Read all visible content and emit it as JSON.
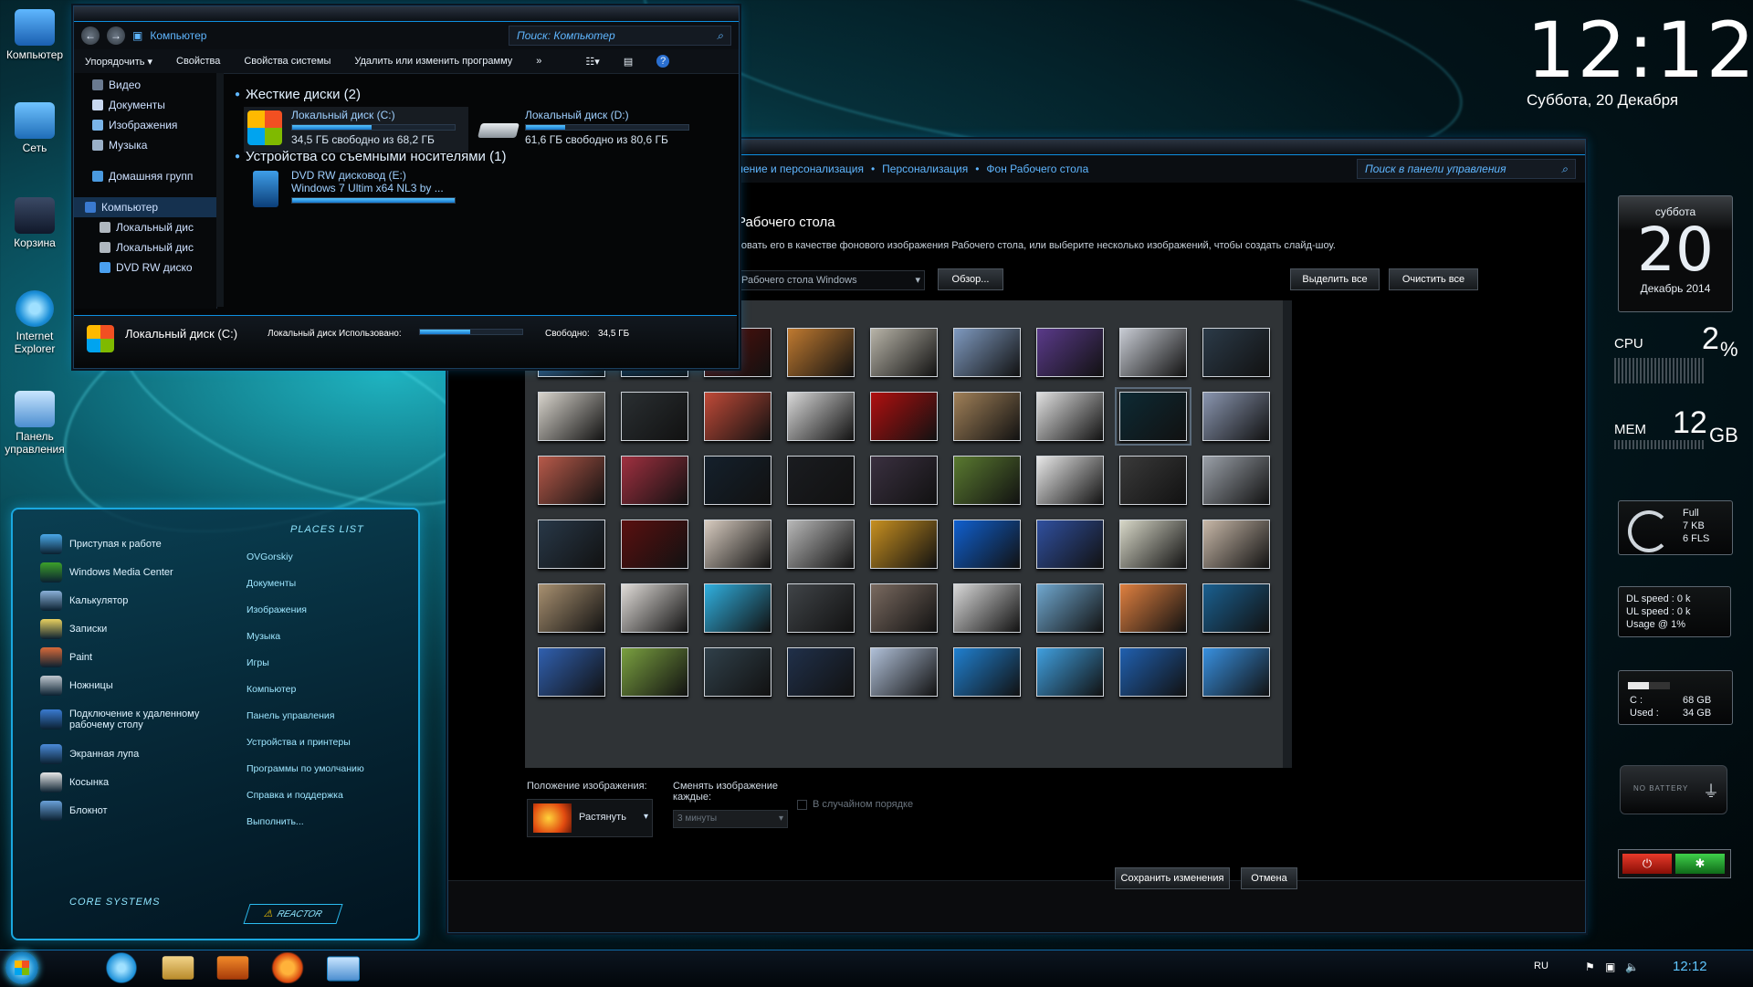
{
  "desktop_icons": [
    {
      "label": "Компьютер",
      "icon": "computer-icon"
    },
    {
      "label": "Сеть",
      "icon": "network-icon"
    },
    {
      "label": "Корзина",
      "icon": "recycle-bin-icon"
    },
    {
      "label": "Internet Explorer",
      "icon": "ie-icon"
    },
    {
      "label": "Панель управления",
      "icon": "control-panel-icon"
    }
  ],
  "clock": {
    "time": "12:12",
    "date": "Суббота, 20 Декабря"
  },
  "explorer": {
    "breadcrumb": "Компьютер",
    "search_placeholder": "Поиск: Компьютер",
    "toolbar": [
      "Упорядочить ▾",
      "Свойства",
      "Свойства системы",
      "Удалить или изменить программу",
      "»"
    ],
    "nav": [
      {
        "label": "Видео",
        "icon": "video-folder-icon"
      },
      {
        "label": "Документы",
        "icon": "documents-folder-icon"
      },
      {
        "label": "Изображения",
        "icon": "pictures-folder-icon"
      },
      {
        "label": "Музыка",
        "icon": "music-folder-icon"
      },
      {
        "label": "Домашняя групп",
        "icon": "homegroup-icon"
      },
      {
        "label": "Компьютер",
        "icon": "computer-icon"
      },
      {
        "label": "Локальный дис",
        "icon": "drive-icon"
      },
      {
        "label": "Локальный дис",
        "icon": "drive-icon"
      },
      {
        "label": "DVD RW диско",
        "icon": "dvd-icon"
      }
    ],
    "group_hdd": "Жесткие диски (2)",
    "group_removable": "Устройства со съемными носителями (1)",
    "drives": [
      {
        "name": "Локальный диск (C:)",
        "free": "34,5 ГБ свободно из 68,2 ГБ",
        "used_fraction": 0.49
      },
      {
        "name": "Локальный диск (D:)",
        "free": "61,6 ГБ свободно из 80,6 ГБ",
        "used_fraction": 0.24
      },
      {
        "name": "DVD RW дисковод (E:)",
        "free": "Windows 7 Ultim x64 NL3 by ...",
        "used_fraction": 1.0
      }
    ],
    "details": {
      "title": "Локальный диск (C:)",
      "type": "Локальный диск",
      "used_label": "Использовано:",
      "free_label": "Свободно:",
      "free_value": "34,5 ГБ"
    }
  },
  "control_panel": {
    "breadcrumb": [
      "ление и персонализация",
      "Персонализация",
      "Фон Рабочего стола"
    ],
    "search_placeholder": "Поиск в панели управления",
    "heading": "Рабочего стола",
    "description": "зовать его в качестве фонового изображения Рабочего стола, или выберите несколько изображений, чтобы создать слайд-шоу.",
    "location_value": "Рабочего стола Windows",
    "browse": "Обзор...",
    "select_all": "Выделить все",
    "clear_all": "Очистить все",
    "position_label": "Положение изображения:",
    "position_value": "Растянуть",
    "interval_label": "Сменять изображение каждые:",
    "interval_value": "3 минуты",
    "shuffle_label": "В случайном порядке",
    "save": "Сохранить изменения",
    "cancel": "Отмена",
    "thumb_colors": [
      [
        "#3a6ea0",
        "#12304a",
        "#5a0f0a",
        "#c07a30",
        "#b8b4a8",
        "#7f9ac0",
        "#5a3a8a",
        "#c8ccd4",
        "#2b3a48"
      ],
      [
        "#d8d4cc",
        "#2a2f32",
        "#c04a38",
        "#d8d8d8",
        "#b01010",
        "#a08058",
        "#e0e0e0",
        "#0d2a34",
        "#8a96b0"
      ],
      [
        "#b85a4a",
        "#a03040",
        "#14202c",
        "#1a1c20",
        "#3a3040",
        "#5a7a30",
        "#e8e8e8",
        "#3a3a3a",
        "#9aa0a8"
      ],
      [
        "#283848",
        "#5a1010",
        "#d8ccc0",
        "#b8b8b8",
        "#c89020",
        "#1060d0",
        "#3050a0",
        "#d8d8c8",
        "#c8b8a8"
      ],
      [
        "#a89070",
        "#e0dcd8",
        "#30b0e0",
        "#404448",
        "#7a6a60",
        "#d8d8d8",
        "#70a8d0",
        "#e08040",
        "#1a6090"
      ],
      [
        "#3060b0",
        "#7aa040",
        "#30404a",
        "#20304a",
        "#b0c0d8",
        "#2080d0",
        "#40a0e0",
        "#2060b0",
        "#3890e0"
      ]
    ]
  },
  "start_menu": {
    "left": [
      {
        "label": "Приступая к работе",
        "icon": "getting-started-icon"
      },
      {
        "label": "Windows Media Center",
        "icon": "media-center-icon"
      },
      {
        "label": "Калькулятор",
        "icon": "calculator-icon"
      },
      {
        "label": "Записки",
        "icon": "sticky-notes-icon"
      },
      {
        "label": "Paint",
        "icon": "paint-icon"
      },
      {
        "label": "Ножницы",
        "icon": "snipping-tool-icon"
      },
      {
        "label": "Подключение к удаленному рабочему столу",
        "icon": "remote-desktop-icon"
      },
      {
        "label": "Экранная лупа",
        "icon": "magnifier-icon"
      },
      {
        "label": "Косынка",
        "icon": "solitaire-icon"
      },
      {
        "label": "Блокнот",
        "icon": "notepad-icon"
      }
    ],
    "places_title": "PLACES LIST",
    "right": [
      "OVGorskiy",
      "Документы",
      "Изображения",
      "Музыка",
      "Игры",
      "Компьютер",
      "Панель управления",
      "Устройства и принтеры",
      "Программы по умолчанию",
      "Справка и поддержка",
      "Выполнить..."
    ],
    "core_label": "CORE SYSTEMS",
    "reactor_label": "REACTOR"
  },
  "gadgets": {
    "calendar": {
      "weekday": "суббота",
      "day": "20",
      "month": "Декабрь 2014"
    },
    "cpu": {
      "label": "CPU",
      "value": "2",
      "unit": "%"
    },
    "mem": {
      "label": "MEM",
      "value": "12",
      "unit": "GB"
    },
    "recycle": {
      "status": "Full",
      "size": "7 KB",
      "files": "6 FLS"
    },
    "network": {
      "dl": "DL speed : 0 k",
      "ul": "UL speed : 0 k",
      "usage": "Usage @ 1%"
    },
    "drive": {
      "c_label": "C :",
      "c_value": "68 GB",
      "used_label": "Used :",
      "used_value": "34 GB",
      "used_fraction": 0.5
    },
    "battery": {
      "text": "NO BATTERY"
    }
  },
  "taskbar": {
    "lang": "RU",
    "time": "12:12",
    "apps": [
      "ie-icon",
      "explorer-icon",
      "media-player-icon",
      "firefox-icon",
      "control-panel-icon"
    ]
  }
}
